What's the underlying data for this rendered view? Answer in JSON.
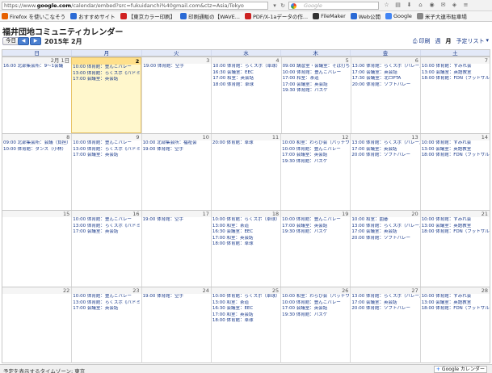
{
  "browser": {
    "url_prefix": "https://www.",
    "url_host": "google.com",
    "url_rest": "/calendar/embed?src=fukuidanchi%40gmail.com&ctz=Asia/Tokyo",
    "search_placeholder": "Google",
    "bookmarks": [
      {
        "label": "Firefox を使いこなそう",
        "color": "#e66000"
      },
      {
        "label": "おすすめサイト",
        "color": "#2a6ad5"
      },
      {
        "label": "【東京カラー印刷】",
        "color": "#d02020"
      },
      {
        "label": "印刷通販の【WAVE...",
        "color": "#2a6ad5"
      },
      {
        "label": "PDF/X-1aデータの作...",
        "color": "#cc2222"
      },
      {
        "label": "FileMaker",
        "color": "#333333"
      },
      {
        "label": "Web公開",
        "color": "#2a6ad5"
      },
      {
        "label": "Google",
        "color": "#4285f4"
      },
      {
        "label": "米子大連市駐車場",
        "color": "#888888"
      }
    ]
  },
  "calendar": {
    "title": "福井団地コミュニティカレンダー",
    "today_label": "今日",
    "prev_label": "◀",
    "next_label": "▶",
    "current_month": "2015年 2月",
    "print_label": "印刷",
    "view_week": "週",
    "view_month": "月",
    "view_agenda": "予定リスト",
    "weekdays": [
      "日",
      "月",
      "火",
      "水",
      "木",
      "金",
      "土"
    ],
    "weeks": [
      {
        "days": [
          {
            "num": "2月 1日",
            "events": [
              "16:00 北部集会所：9～1会議"
            ]
          },
          {
            "num": "2",
            "today": true,
            "events": [
              "10:00 体育館：豊んこバレー",
              "13:00 体育館：らくスポ《バドミ",
              "17:00 会議室：英会話"
            ]
          },
          {
            "num": "3",
            "events": [
              "19:00 体育館：空手"
            ]
          },
          {
            "num": "4",
            "events": [
              "10:00 体育館：らくスポ（卓球）",
              "16:30 会議室：EEC",
              "17:00 和室：英会話",
              "18:00 体育館：卓球"
            ]
          },
          {
            "num": "5",
            "events": [
              "09:00 講習室・会議室：そば打ち",
              "10:00 体育館：豊んこバレー",
              "17:00 和室：茶道",
              "17:00 会議室：英会話",
              "19:30 体育館：バスケ"
            ]
          },
          {
            "num": "6",
            "events": [
              "13:00 体育館：らくスポ（バレー）",
              "17:00 会議室：英会話",
              "17:30 会議室：北ロPTA",
              "20:00 体育館：ソフトバレー"
            ]
          },
          {
            "num": "7",
            "events": [
              "10:00 体育館：すみれ会",
              "13:00 会議室：英語教室",
              "18:00 体育館：FDN（フットサル）"
            ]
          }
        ]
      },
      {
        "days": [
          {
            "num": "8",
            "events": [
              "09:00 北部集会所：会議（負担）",
              "10:00 体育館：ダンス（小林）"
            ]
          },
          {
            "num": "9",
            "events": [
              "10:00 体育館：豊んこバレー",
              "13:00 体育館：らくスポ《バドミ",
              "17:00 会議室：英会話"
            ]
          },
          {
            "num": "10",
            "events": [
              "10:00 北部集会所：福祉会",
              "19:00 体育館：空手"
            ]
          },
          {
            "num": "11",
            "events": [
              "20:00 体育館：卓球"
            ]
          },
          {
            "num": "12",
            "events": [
              "10:00 和室：わらび会（パッチワー",
              "10:00 体育館：豊んこバレー",
              "17:00 会議室：英会話",
              "19:30 体育館：バスケ"
            ]
          },
          {
            "num": "13",
            "events": [
              "13:00 体育館：らくスポ（バレー）",
              "17:00 会議室：英会話",
              "20:00 体育館：ソフトバレー"
            ]
          },
          {
            "num": "14",
            "events": [
              "10:00 体育館：すみれ会",
              "13:00 会議室：英語教室",
              "18:00 体育館：FDN（フットサル）"
            ]
          }
        ]
      },
      {
        "days": [
          {
            "num": "15",
            "events": []
          },
          {
            "num": "16",
            "events": [
              "10:00 体育館：豊んこバレー",
              "13:00 体育館：らくスポ《バドミ",
              "17:00 会議室：英会話"
            ]
          },
          {
            "num": "17",
            "events": [
              "19:00 体育館：空手"
            ]
          },
          {
            "num": "18",
            "events": [
              "10:00 体育館：らくスポ（卓球）",
              "13:00 和室：茶道",
              "16:30 会議室：EEC",
              "17:00 和室：英会話",
              "18:00 体育館：卓球"
            ]
          },
          {
            "num": "19",
            "events": [
              "10:00 体育館：豊んこバレー",
              "17:00 会議室：英会話",
              "19:30 体育館：バスケ"
            ]
          },
          {
            "num": "20",
            "events": [
              "10:00 和室：囲碁",
              "13:00 体育館：らくスポ（バレー）",
              "17:00 会議室：英会話",
              "20:00 体育館：ソフトバレー"
            ]
          },
          {
            "num": "21",
            "events": [
              "10:00 体育館：すみれ会",
              "13:00 会議室：英語教室",
              "18:00 体育館：FDN（フットサル）"
            ]
          }
        ]
      },
      {
        "days": [
          {
            "num": "22",
            "events": []
          },
          {
            "num": "23",
            "events": [
              "10:00 体育館：豊んこバレー",
              "13:00 体育館：らくスポ《バドミ",
              "17:00 会議室：英会話"
            ]
          },
          {
            "num": "24",
            "events": [
              "19:00 体育館：空手"
            ]
          },
          {
            "num": "25",
            "events": [
              "10:00 体育館：らくスポ（卓球）",
              "13:00 和室：茶道",
              "16:30 会議室：EEC",
              "17:00 和室：英会話",
              "18:00 体育館：卓球"
            ]
          },
          {
            "num": "26",
            "events": [
              "10:00 和室：わらび会（パッチワー",
              "10:00 体育館：豊んこバレー",
              "17:00 会議室：英会話",
              "19:30 体育館：バスケ"
            ]
          },
          {
            "num": "27",
            "events": [
              "13:00 体育館：らくスポ（バレー）",
              "17:00 会議室：英会話",
              "20:00 体育館：ソフトバレー"
            ]
          },
          {
            "num": "28",
            "events": [
              "10:00 体育館：すみれ会",
              "13:00 会議室：英語教室",
              "18:00 体育館：FDN（フットサル）"
            ]
          }
        ]
      }
    ],
    "timezone_label": "予定を表示するタイムゾーン: 東京",
    "badge_label": "Google カレンダー"
  }
}
